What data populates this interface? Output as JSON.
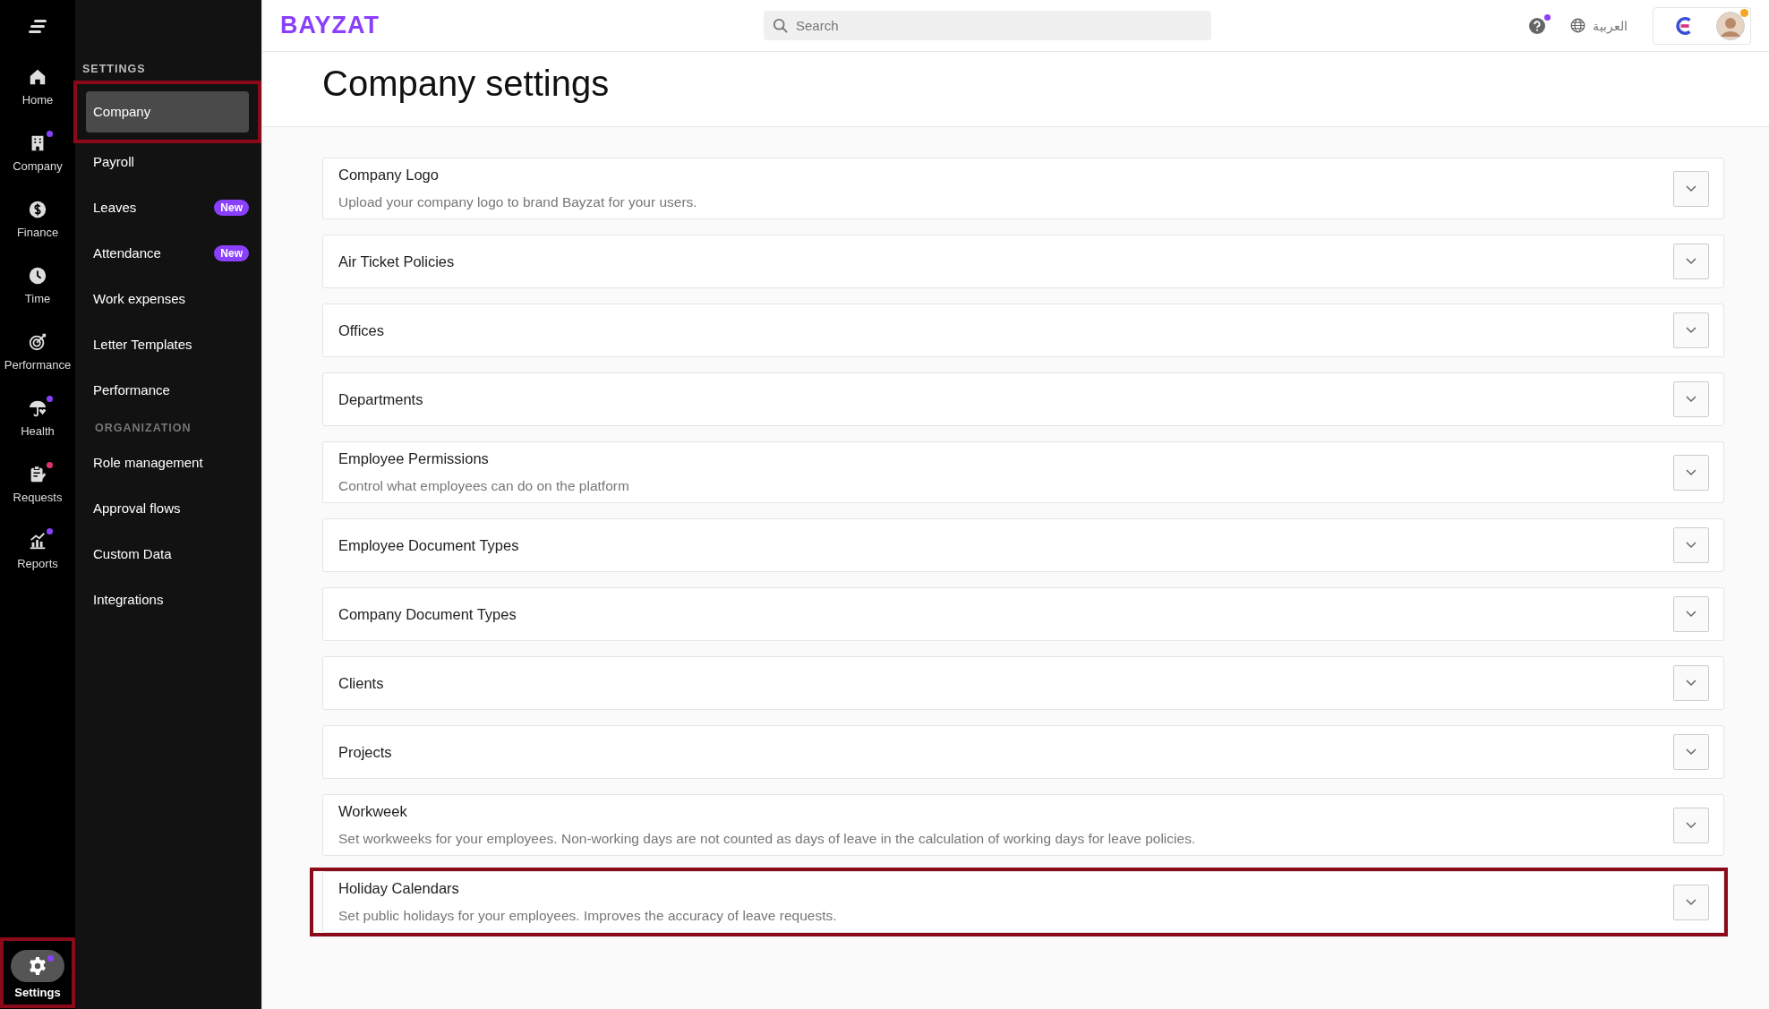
{
  "rail": {
    "items": [
      {
        "label": "Home",
        "selected": false
      },
      {
        "label": "Company",
        "selected": false,
        "color": "#8a3ffc"
      },
      {
        "label": "Finance",
        "selected": false
      },
      {
        "label": "Time",
        "selected": false
      },
      {
        "label": "Performance",
        "selected": false
      },
      {
        "label": "Health",
        "selected": false,
        "color": "#8a3ffc"
      },
      {
        "label": "Requests",
        "selected": false,
        "color": "#e0336e"
      },
      {
        "label": "Reports",
        "selected": false,
        "color": "#8a3ffc"
      }
    ],
    "settings": {
      "label": "Settings",
      "selected": true,
      "color": "#8a3ffc",
      "highlighted": true
    }
  },
  "subnav": {
    "groups": [
      {
        "title": "SETTINGS",
        "items": [
          {
            "label": "Company",
            "selected": true,
            "highlighted": true
          },
          {
            "label": "Payroll",
            "selected": false,
            "highlighted": false
          },
          {
            "label": "Leaves",
            "selected": false,
            "highlighted": false,
            "badge": "New"
          },
          {
            "label": "Attendance",
            "selected": false,
            "highlighted": false,
            "badge": "New"
          },
          {
            "label": "Work expenses",
            "selected": false,
            "highlighted": false
          },
          {
            "label": "Letter Templates",
            "selected": false,
            "highlighted": false
          },
          {
            "label": "Performance",
            "selected": false,
            "highlighted": false
          }
        ]
      },
      {
        "title": "ORGANIZATION",
        "items": [
          {
            "label": "Role management",
            "selected": false,
            "highlighted": false
          },
          {
            "label": "Approval flows",
            "selected": false,
            "highlighted": false
          },
          {
            "label": "Custom Data",
            "selected": false,
            "highlighted": false
          },
          {
            "label": "Integrations",
            "selected": false,
            "highlighted": false
          }
        ]
      }
    ]
  },
  "topbar": {
    "logo": "BAYZAT",
    "search": {
      "placeholder": "Search"
    },
    "help": {
      "color": "#8a3ffc"
    },
    "language": "العربية",
    "avatar": {
      "color": "#f5a623"
    }
  },
  "page": {
    "title": "Company settings"
  },
  "sections": [
    {
      "title": "Company Logo",
      "description": "Upload your company logo to brand Bayzat for your users.",
      "expanded": false,
      "highlighted": false
    },
    {
      "title": "Air Ticket Policies",
      "expanded": false,
      "highlighted": false
    },
    {
      "title": "Offices",
      "expanded": false,
      "highlighted": false
    },
    {
      "title": "Departments",
      "expanded": false,
      "highlighted": false
    },
    {
      "title": "Employee Permissions",
      "description": "Control what employees can do on the platform",
      "expanded": false,
      "highlighted": false
    },
    {
      "title": "Employee Document Types",
      "expanded": false,
      "highlighted": false
    },
    {
      "title": "Company Document Types",
      "expanded": false,
      "highlighted": false
    },
    {
      "title": "Clients",
      "expanded": false,
      "highlighted": false
    },
    {
      "title": "Projects",
      "expanded": false,
      "highlighted": false
    },
    {
      "title": "Workweek",
      "description": "Set workweeks for your employees. Non-working days are not counted as days of leave in the calculation of working days for leave policies.",
      "expanded": false,
      "highlighted": false
    },
    {
      "title": "Holiday Calendars",
      "description": "Set public holidays for your employees. Improves the accuracy of leave requests.",
      "expanded": false,
      "highlighted": true
    }
  ]
}
